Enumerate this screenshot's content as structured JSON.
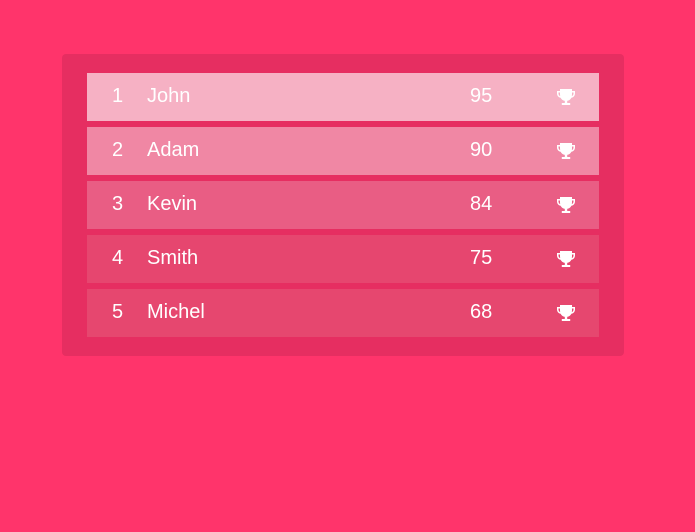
{
  "leaderboard": {
    "rows": [
      {
        "rank": "1",
        "name": "John",
        "score": "95",
        "icon": "trophy-icon"
      },
      {
        "rank": "2",
        "name": "Adam",
        "score": "90",
        "icon": "trophy-icon"
      },
      {
        "rank": "3",
        "name": "Kevin",
        "score": "84",
        "icon": "trophy-icon"
      },
      {
        "rank": "4",
        "name": "Smith",
        "score": "75",
        "icon": "trophy-icon"
      },
      {
        "rank": "5",
        "name": "Michel",
        "score": "68",
        "icon": "trophy-icon"
      }
    ]
  },
  "colors": {
    "background": "#ff346b",
    "panel": "#e62e61",
    "text": "#ffffff"
  }
}
